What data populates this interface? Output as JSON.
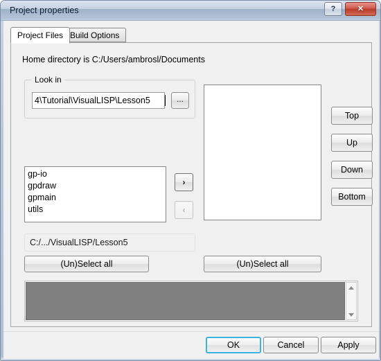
{
  "window": {
    "title": "Project properties",
    "help_label": "?",
    "close_label": "✕",
    "frame_color": "#7a8ca3",
    "close_color": "#b83a28",
    "default_button_focus_color": "#39b4e0"
  },
  "tabs": [
    {
      "label": "Project Files",
      "active": true
    },
    {
      "label": "Build Options",
      "active": false
    }
  ],
  "page": {
    "home_directory_text": "Home directory is C:/Users/ambrosl/Documents",
    "lookin": {
      "legend": "Look in",
      "value": "4\\Tutorial\\VisualLISP\\Lesson5",
      "placeholder": "",
      "browse_label": "..."
    },
    "source_list": {
      "items": [
        "gp-io",
        "gpdraw",
        "gpmain",
        "utils"
      ]
    },
    "move_buttons": {
      "add_label": "›",
      "remove_label": "‹",
      "add_enabled": true,
      "remove_enabled": false
    },
    "path_readonly": "C:/.../VisualLISP/Lesson5",
    "target_list": {
      "items": []
    },
    "order_buttons": [
      {
        "label": "Top"
      },
      {
        "label": "Up"
      },
      {
        "label": "Down"
      },
      {
        "label": "Bottom"
      }
    ],
    "select_all_left": "(Un)Select all",
    "select_all_right": "(Un)Select all",
    "log_area": {
      "value": "",
      "fill_color": "#808080",
      "scroll_up": "▲",
      "scroll_down": "▼"
    }
  },
  "footer": {
    "ok_label": "OK",
    "cancel_label": "Cancel",
    "apply_label": "Apply"
  }
}
